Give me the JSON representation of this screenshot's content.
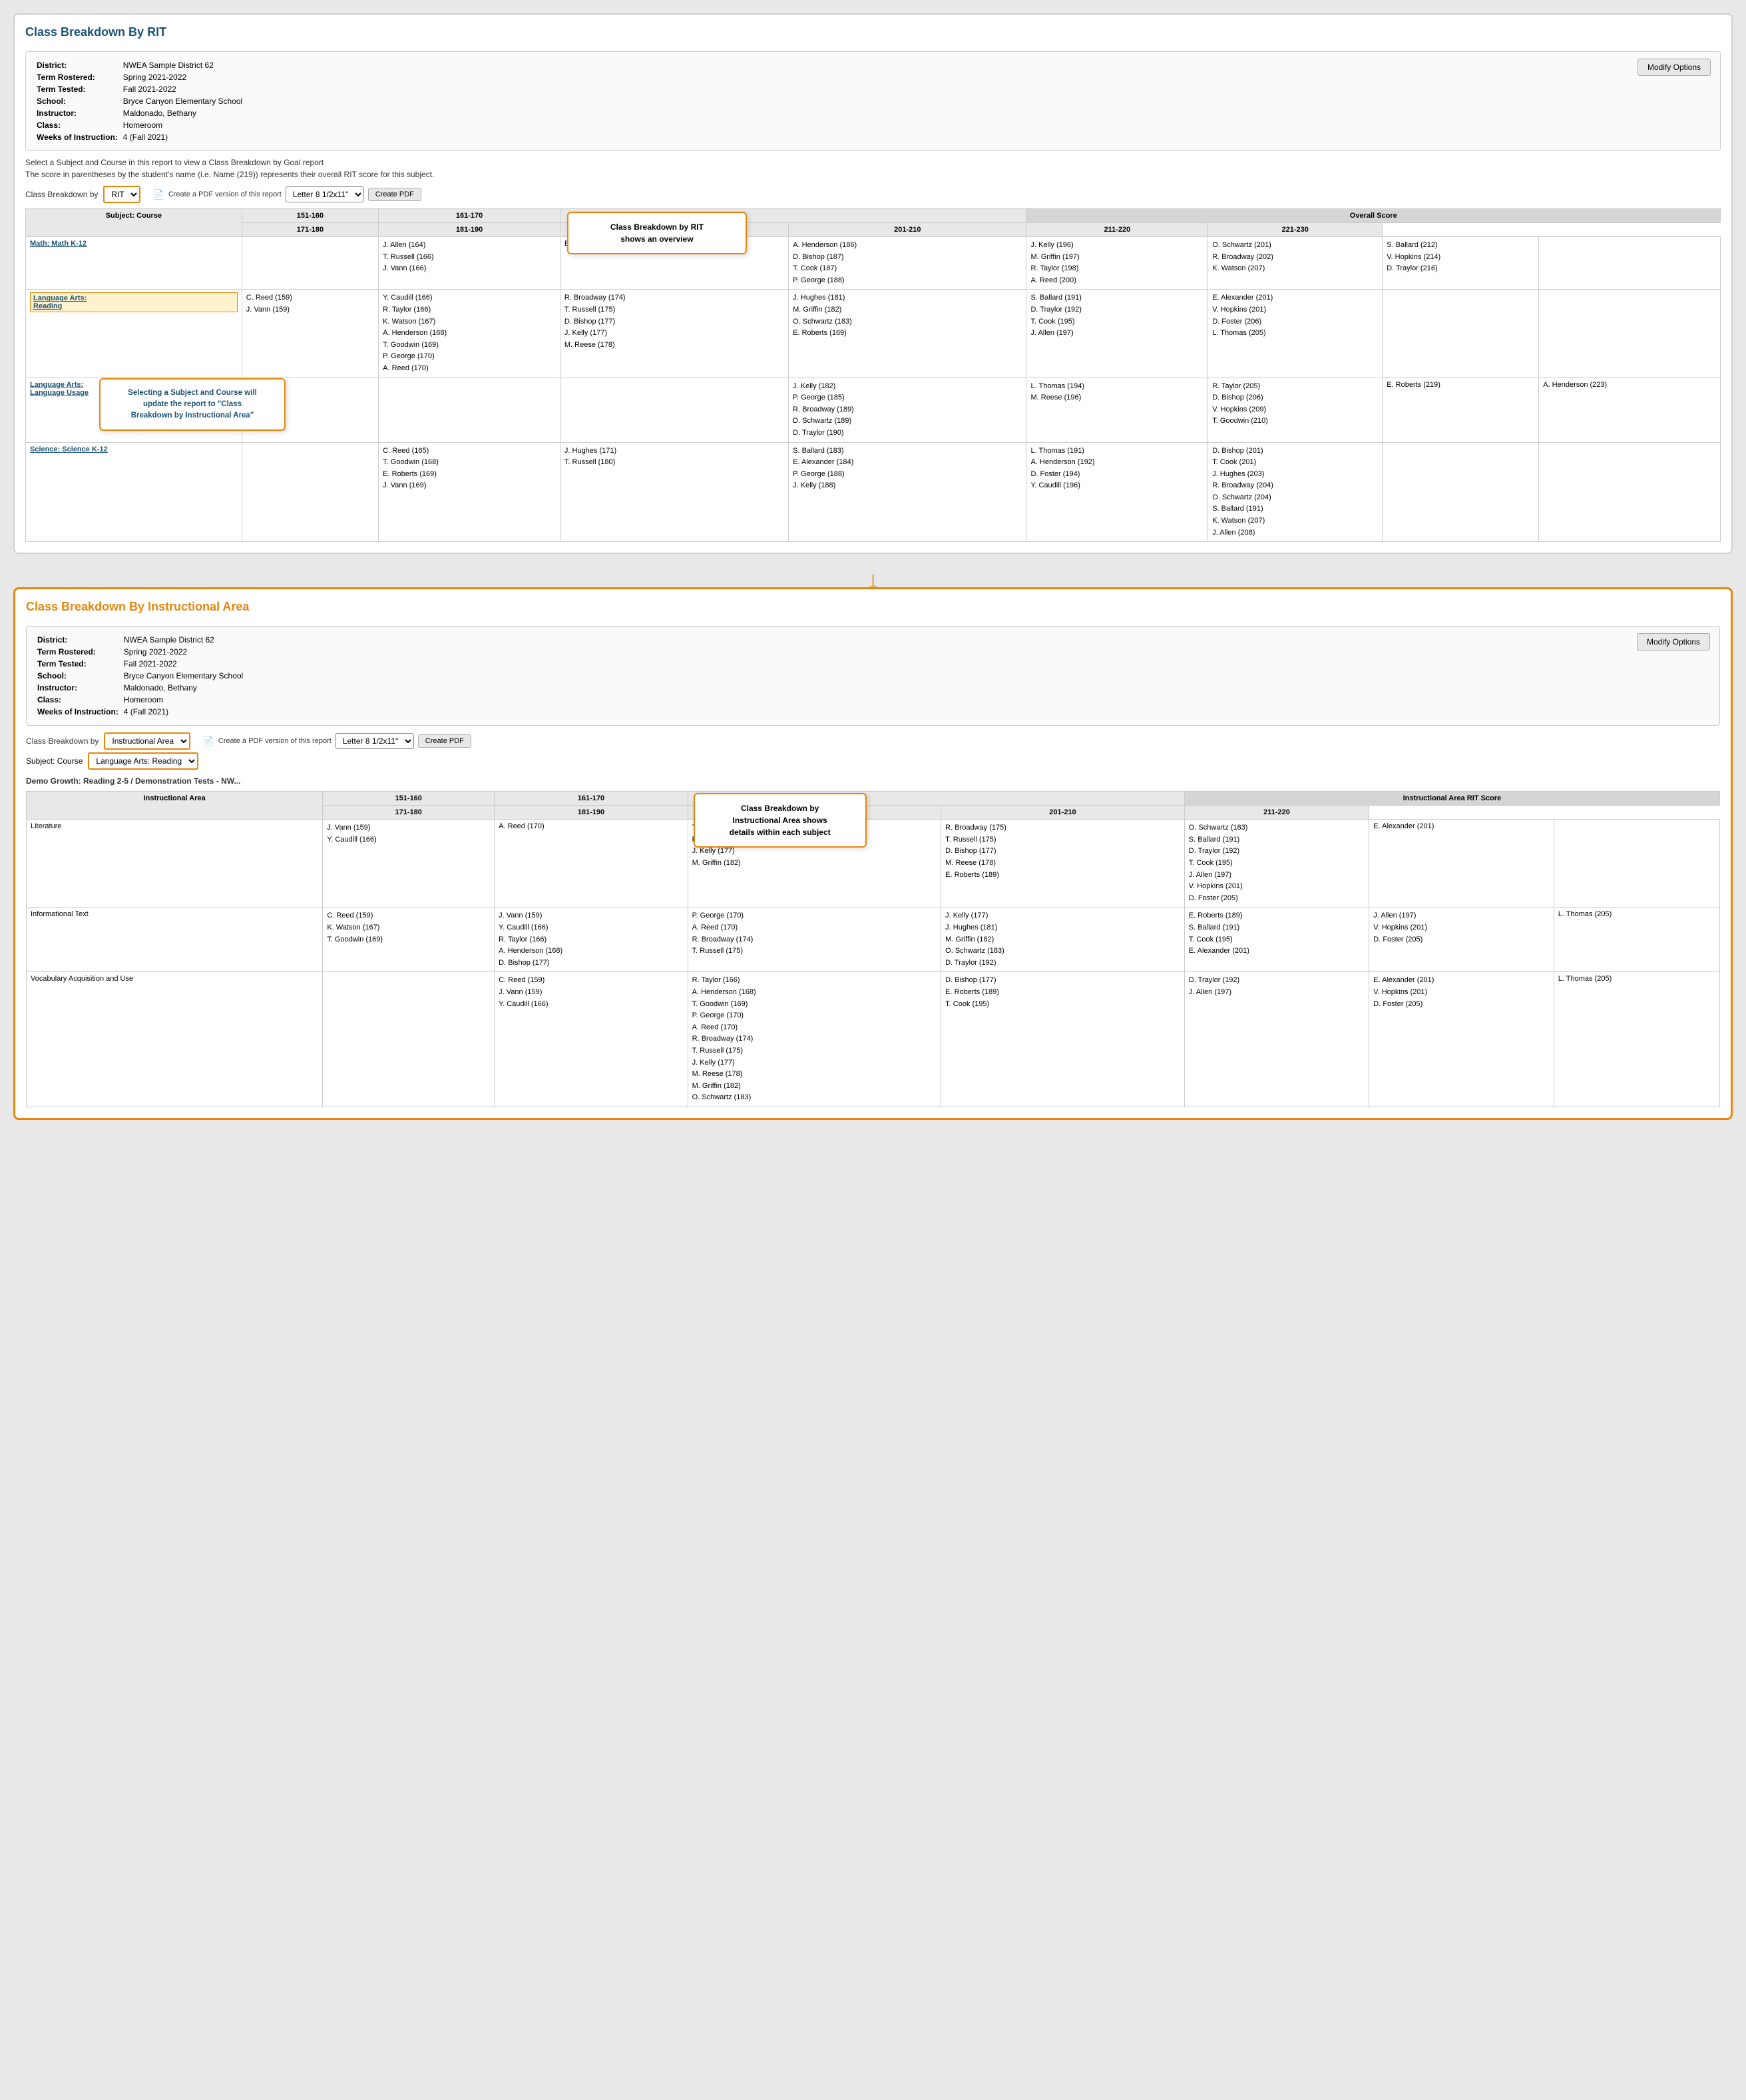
{
  "report1": {
    "title": "Class Breakdown By RIT",
    "info": {
      "district_label": "District:",
      "district_value": "NWEA Sample District 62",
      "term_rostered_label": "Term Rostered:",
      "term_rostered_value": "Spring 2021-2022",
      "term_tested_label": "Term Tested:",
      "term_tested_value": "Fall 2021-2022",
      "school_label": "School:",
      "school_value": "Bryce Canyon Elementary School",
      "instructor_label": "Instructor:",
      "instructor_value": "Maldonado, Bethany",
      "class_label": "Class:",
      "class_value": "Homeroom",
      "weeks_label": "Weeks of Instruction:",
      "weeks_value": "4 (Fall 2021)"
    },
    "modify_btn": "Modify Options",
    "hint1": "Select a Subject and Course in this report to view a Class Breakdown by Goal report",
    "hint2": "The score in parentheses by the student's name (i.e. Name (219)) represents their overall RIT score for this subject.",
    "controls": {
      "label": "Class Breakdown by",
      "dropdown_value": "RIT",
      "pdf_label": "Create a PDF version of this report",
      "pdf_size": "Letter 8 1/2x11\"",
      "create_pdf": "Create PDF"
    },
    "callout1": {
      "text": "Class Breakdown by RIT\nshows an overview"
    },
    "callout2": {
      "text": "Selecting a Subject and Course will\nupdate the report to \"Class\nBreakdown by Instructional Area\""
    },
    "table": {
      "col_subject": "Subject: Course",
      "col_151_160": "151-160",
      "col_161_170": "161-170",
      "col_171_180": "171-180",
      "col_181_190": "181-190",
      "overall_score": "Overall Score",
      "col_191_200": "191-200",
      "col_201_210": "201-210",
      "col_211_220": "211-220",
      "col_221_230": "221-230",
      "rows": [
        {
          "subject": "Math: Math K-12",
          "is_link": true,
          "is_highlighted": false,
          "cells": {
            "151_160": "",
            "161_170": "J. Allen (164)\nT. Russell (166)\nJ. Vann (166)",
            "171_180": "E. Roberts (178)",
            "181_190": "A. Henderson (186)\nD. Bishop (187)\nT. Cook (187)\nP. George (188)",
            "191_200": "J. Kelly (196)\nM. Griffin (197)\nR. Taylor (198)\nA. Reed (200)",
            "201_210": "O. Schwartz (201)\nR. Broadway (202)\nK. Watson (207)",
            "211_220": "S. Ballard (212)\nV. Hopkins (214)\nD. Traylor (216)",
            "221_230": ""
          }
        },
        {
          "subject": "Language Arts: Reading",
          "is_link": true,
          "is_highlighted": true,
          "cells": {
            "151_160": "C. Reed (159)\nJ. Vann (159)",
            "161_170": "Y. Caudill (166)\nR. Taylor (166)\nK. Watson (167)\nA. Henderson (168)\nT. Goodwin (169)\nP. George (170)\nA. Reed (170)",
            "171_180": "R. Broadway (174)\nT. Russell (175)\nD. Bishop (177)\nJ. Kelly (177)\nM. Reese (178)",
            "181_190": "J. Hughes (181)\nM. Griffin (182)\nO. Schwartz (183)\nE. Roberts (169)",
            "191_200": "S. Ballard (191)\nD. Traylor (192)\nT. Cook (195)\nJ. Allen (197)",
            "201_210": "E. Alexander (201)\nV. Hopkins (201)\nD. Foster (206)\nL. Thomas (205)",
            "211_220": "",
            "221_230": ""
          }
        },
        {
          "subject": "Language Arts: Language Usage",
          "is_link": true,
          "is_highlighted": false,
          "cells": {
            "151_160": "",
            "161_170": "",
            "171_180": "",
            "181_190": "J. Kelly (182)\nP. George (185)\nR. Broadway (189)\nD. Schwartz (189)\nD. Traylor (190)",
            "191_200": "L. Thomas (194)\nM. Reese (196)",
            "201_210": "R. Taylor (205)\nD. Bishop (206)\nV. Hopkins (209)\nT. Goodwin (210)",
            "211_220": "E. Roberts (219)",
            "221_230": "A. Henderson (223)"
          }
        },
        {
          "subject": "Science: Science K-12",
          "is_link": true,
          "is_highlighted": false,
          "cells": {
            "151_160": "",
            "161_170": "C. Reed (165)\nT. Goodwin (168)\nE. Roberts (169)\nJ. Vann (169)",
            "171_180": "J. Hughes (171)\nT. Russell (180)",
            "181_190": "S. Ballard (183)\nE. Alexander (184)\nP. George (188)\nJ. Kelly (188)",
            "191_200": "L. Thomas (191)\nA. Henderson (192)\nD. Foster (194)\nY. Caudill (196)",
            "201_210": "D. Bishop (201)\nT. Cook (201)\nJ. Hughes (203)\nR. Broadway (204)\nO. Schwartz (204)\nS. Ballard (191)\nK. Watson (207)\nJ. Allen (208)",
            "211_220": "",
            "221_230": ""
          }
        }
      ]
    }
  },
  "report2": {
    "title": "Class Breakdown By Instructional Area",
    "info": {
      "district_label": "District:",
      "district_value": "NWEA Sample District 62",
      "term_rostered_label": "Term Rostered:",
      "term_rostered_value": "Spring 2021-2022",
      "term_tested_label": "Term Tested:",
      "term_tested_value": "Fall 2021-2022",
      "school_label": "School:",
      "school_value": "Bryce Canyon Elementary School",
      "instructor_label": "Instructor:",
      "instructor_value": "Maldonado, Bethany",
      "class_label": "Class:",
      "class_value": "Homeroom",
      "weeks_label": "Weeks of Instruction:",
      "weeks_value": "4 (Fall 2021)"
    },
    "modify_btn": "Modify Options",
    "controls": {
      "label": "Class Breakdown by",
      "dropdown_value": "Instructional Area",
      "pdf_label": "Create a PDF version of this report",
      "pdf_size": "Letter 8 1/2x11\"",
      "create_pdf": "Create PDF",
      "subject_label": "Subject: Course",
      "subject_value": "Language Arts: Reading"
    },
    "demo_growth": "Demo Growth: Reading 2-5 / Demonstration Tests - NW...",
    "callout": {
      "text": "Class Breakdown by\nInstructional Area shows\ndetails within each subject"
    },
    "table": {
      "col_ia": "Instructional Area",
      "col_151_160": "151-160",
      "col_161_170": "161-170",
      "col_171_180": "171-180",
      "ia_score": "Instructional Area RIT Score",
      "col_181_190": "181-190",
      "col_191_200": "191-200",
      "col_201_210": "201-210",
      "col_211_220": "211-220",
      "rows": [
        {
          "ia": "Literature",
          "cells": {
            "151_160": "J. Vann (159)\nY. Caudill (166)",
            "161_170": "A. Reed (170)",
            "171_180": "T. Goodwin (169)\nP. George (170)\nJ. Kelly (177)\nM. Griffin (182)",
            "181_190": "R. Broadway (175)\nT. Russell (175)\nD. Bishop (177)\nM. Reese (178)\nE. Roberts (189)",
            "191_200": "O. Schwartz (183)\nS. Ballard (191)\nD. Traylor (192)\nT. Cook (195)\nJ. Allen (197)\nV. Hopkins (201)\nD. Foster (205)",
            "201_210": "E. Alexander (201)",
            "211_220": ""
          }
        },
        {
          "ia": "Informational Text",
          "cells": {
            "151_160": "C. Reed (159)\nK. Watson (167)\nT. Goodwin (169)",
            "161_170": "J. Vann (159)\nY. Caudill (166)\nR. Taylor (166)\nA. Henderson (168)\nD. Bishop (177)",
            "171_180": "P. George (170)\nA. Reed (170)\nR. Broadway (174)\nT. Russell (175)",
            "181_190": "J. Kelly (177)\nJ. Hughes (181)\nM. Griffin (182)\nO. Schwartz (183)\nD. Traylor (192)",
            "191_200": "E. Roberts (189)\nS. Ballard (191)\nT. Cook (195)\nE. Alexander (201)",
            "201_210": "J. Allen (197)\nV. Hopkins (201)\nD. Foster (205)",
            "211_220": "L. Thomas (205)"
          }
        },
        {
          "ia": "Vocabulary Acquisition and Use",
          "cells": {
            "151_160": "",
            "161_170": "C. Reed (159)\nJ. Vann (159)\nY. Caudill (166)",
            "171_180": "R. Taylor (166)\nA. Henderson (168)\nT. Goodwin (169)\nP. George (170)\nA. Reed (170)\nR. Broadway (174)\nT. Russell (175)\nJ. Kelly (177)\nM. Reese (178)\nM. Griffin (182)\nO. Schwartz (183)",
            "181_190": "D. Bishop (177)\nE. Roberts (189)\nT. Cook (195)",
            "191_200": "D. Traylor (192)\nJ. Allen (197)",
            "201_210": "E. Alexander (201)\nV. Hopkins (201)\nD. Foster (205)",
            "211_220": "L. Thomas (205)"
          }
        }
      ]
    }
  },
  "arrow": "↓"
}
